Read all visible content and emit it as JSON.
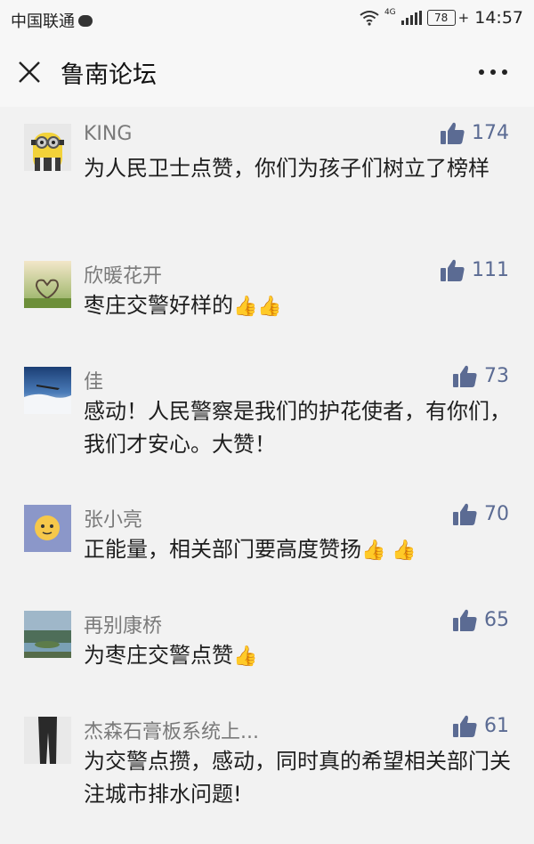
{
  "status_bar": {
    "carrier": "中国联通",
    "network": "4G",
    "battery": "78",
    "time": "14:57"
  },
  "header": {
    "title": "鲁南论坛"
  },
  "comments": [
    {
      "name": "KING",
      "likes": "174",
      "text": "为人民卫士点赞，你们为孩子们树立了榜样",
      "emoji": ""
    },
    {
      "name": "欣暖花开",
      "likes": "111",
      "text": "枣庄交警好样的",
      "emoji": "👍👍"
    },
    {
      "name": "佳",
      "likes": "73",
      "text": "感动！人民警察是我们的护花使者，有你们，我们才安心。大赞！",
      "emoji": ""
    },
    {
      "name": "张小亮",
      "likes": "70",
      "text": "正能量，相关部门要高度赞扬",
      "emoji": "👍 👍"
    },
    {
      "name": "再别康桥",
      "likes": "65",
      "text": "为枣庄交警点赞",
      "emoji": "👍"
    },
    {
      "name": "杰森石膏板系统上...",
      "likes": "61",
      "text": "为交警点攒，感动，同时真的希望相关部门关注城市排水问题!",
      "emoji": ""
    }
  ]
}
